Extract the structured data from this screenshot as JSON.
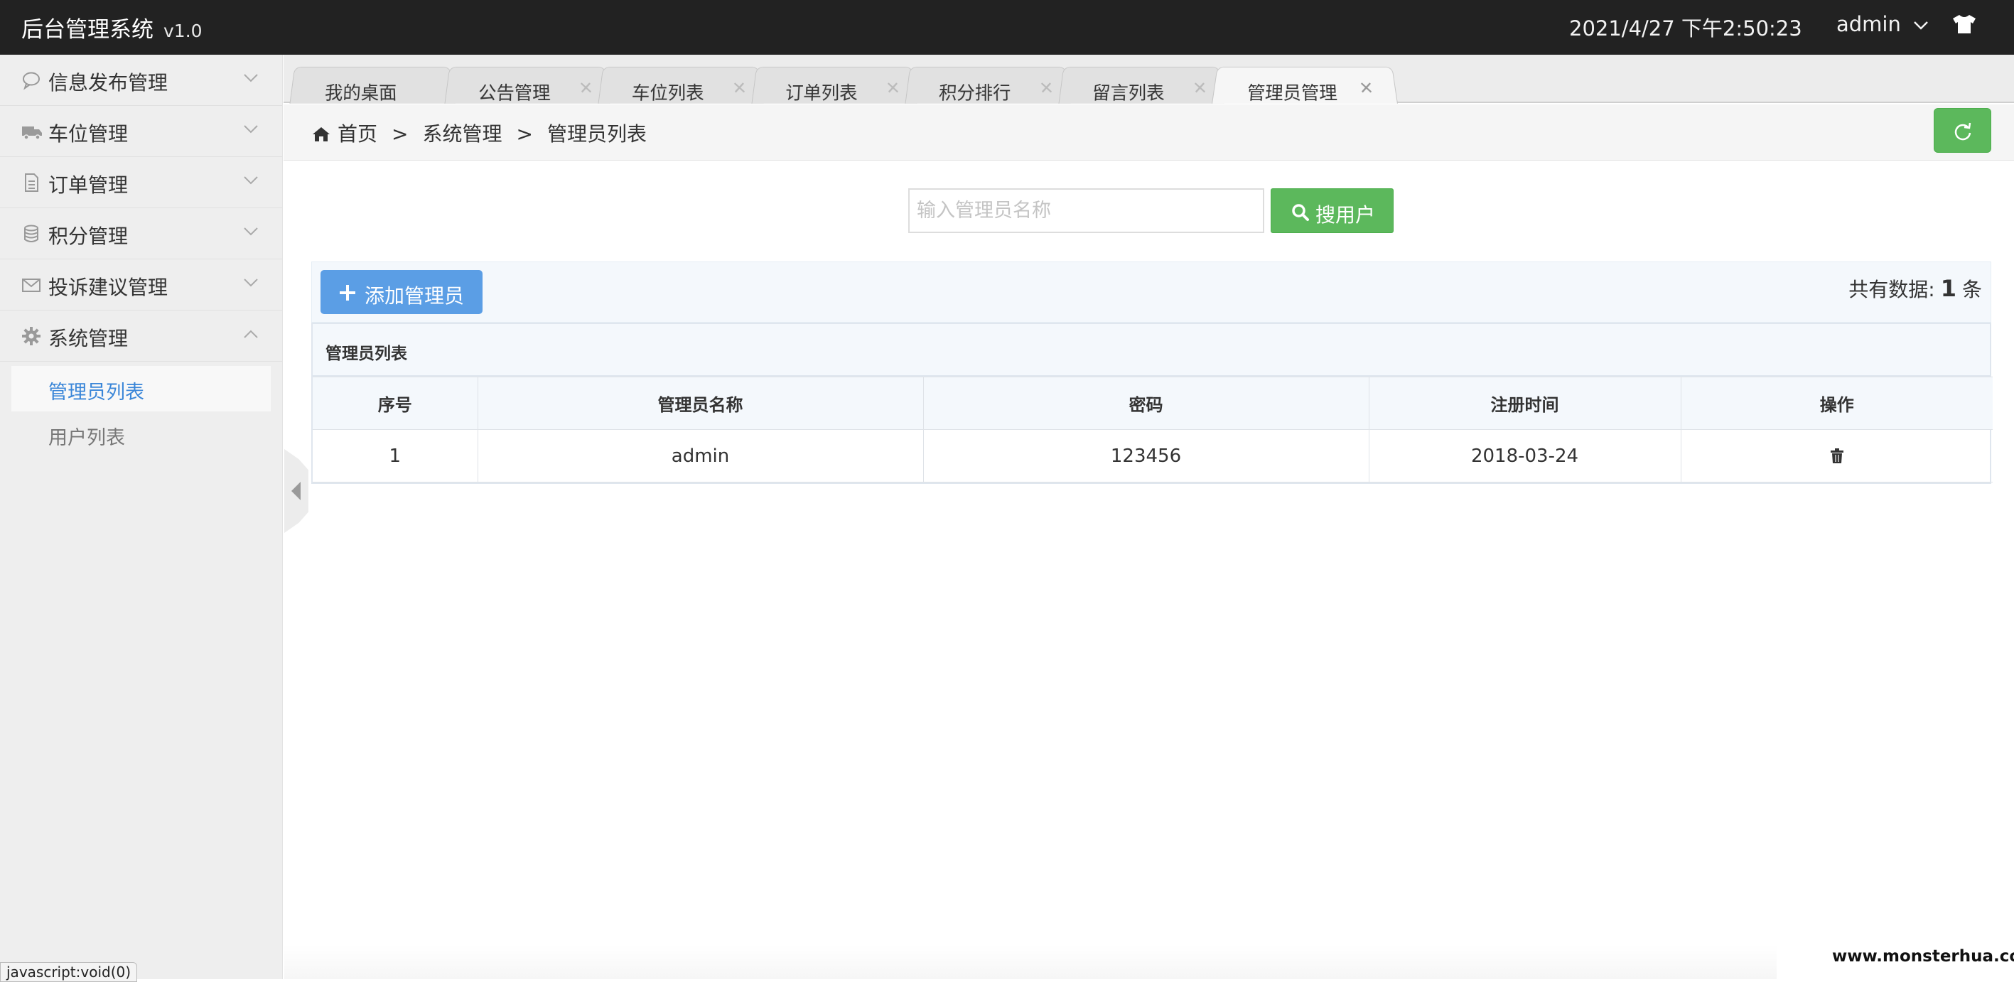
{
  "app": {
    "title": "后台管理系统",
    "version": "v1.0"
  },
  "header": {
    "datetime": "2021/4/27 下午2:50:23",
    "user": "admin"
  },
  "sidebar": {
    "items": [
      {
        "label": "信息发布管理",
        "icon": "chat-bubble-icon"
      },
      {
        "label": "车位管理",
        "icon": "truck-icon"
      },
      {
        "label": "订单管理",
        "icon": "document-icon"
      },
      {
        "label": "积分管理",
        "icon": "database-icon"
      },
      {
        "label": "投诉建议管理",
        "icon": "envelope-icon"
      },
      {
        "label": "系统管理",
        "icon": "gear-icon"
      }
    ],
    "submenu": [
      {
        "label": "管理员列表",
        "active": true
      },
      {
        "label": "用户列表",
        "active": false
      }
    ]
  },
  "tabs": [
    {
      "label": "我的桌面",
      "closable": false
    },
    {
      "label": "公告管理",
      "closable": true
    },
    {
      "label": "车位列表",
      "closable": true
    },
    {
      "label": "订单列表",
      "closable": true
    },
    {
      "label": "积分排行",
      "closable": true
    },
    {
      "label": "留言列表",
      "closable": true
    },
    {
      "label": "管理员管理",
      "closable": true,
      "active": true
    }
  ],
  "breadcrumb": {
    "home": "首页",
    "sep": ">",
    "level1": "系统管理",
    "level2": "管理员列表"
  },
  "search": {
    "placeholder": "输入管理员名称",
    "button": "搜用户"
  },
  "toolbar": {
    "add_button": "添加管理员",
    "total_prefix": "共有数据:",
    "total_count": "1",
    "total_suffix": "条"
  },
  "table": {
    "title": "管理员列表",
    "columns": [
      "序号",
      "管理员名称",
      "密码",
      "注册时间",
      "操作"
    ],
    "rows": [
      {
        "index": "1",
        "name": "admin",
        "password": "123456",
        "registered": "2018-03-24"
      }
    ]
  },
  "status_bar": {
    "link": "javascript:void(0)"
  },
  "watermark": "www.monsterhua.com",
  "colors": {
    "header_bg": "#222222",
    "success": "#5cb85c",
    "primary": "#5b9ee5",
    "active_link": "#3a86d8"
  }
}
